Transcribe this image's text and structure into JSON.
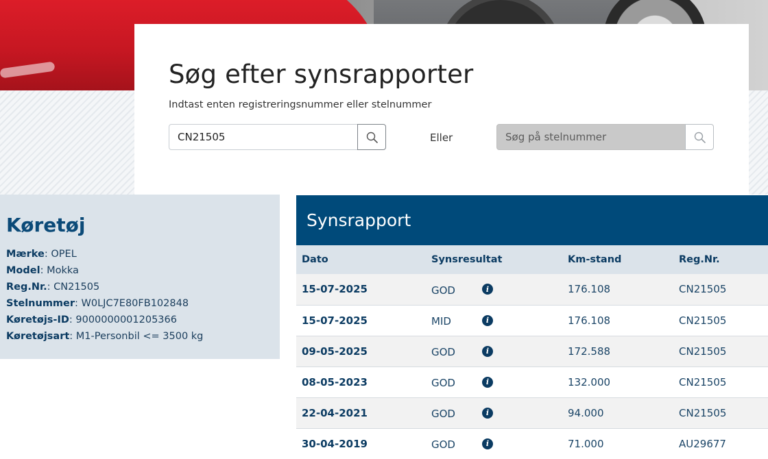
{
  "search": {
    "title": "Søg efter synsrapporter",
    "subtitle": "Indtast enten registreringsnummer eller stelnummer",
    "reg_value": "CN21505",
    "or_label": "Eller",
    "stel_placeholder": "Søg på stelnummer",
    "icon": "search-icon"
  },
  "vehicle": {
    "heading": "Køretøj",
    "fields": [
      {
        "label": "Mærke",
        "value": "OPEL"
      },
      {
        "label": "Model",
        "value": "Mokka"
      },
      {
        "label": "Reg.Nr.",
        "value": "CN21505"
      },
      {
        "label": "Stelnummer",
        "value": "W0LJC7E80FB102848"
      },
      {
        "label": "Køretøjs-ID",
        "value": "9000000001205366"
      },
      {
        "label": "Køretøjsart",
        "value": "M1-Personbil <= 3500 kg"
      }
    ]
  },
  "report": {
    "heading": "Synsrapport",
    "columns": [
      "Dato",
      "Synsresultat",
      "Km-stand",
      "Reg.Nr."
    ],
    "rows": [
      {
        "date": "15-07-2025",
        "result": "GOD",
        "km": "176.108",
        "reg": "CN21505"
      },
      {
        "date": "15-07-2025",
        "result": "MID",
        "km": "176.108",
        "reg": "CN21505"
      },
      {
        "date": "09-05-2025",
        "result": "GOD",
        "km": "172.588",
        "reg": "CN21505"
      },
      {
        "date": "08-05-2023",
        "result": "GOD",
        "km": "132.000",
        "reg": "CN21505"
      },
      {
        "date": "22-04-2021",
        "result": "GOD",
        "km": "94.000",
        "reg": "CN21505"
      },
      {
        "date": "30-04-2019",
        "result": "GOD",
        "km": "71.000",
        "reg": "AU29677"
      }
    ],
    "info_icon": "info-icon"
  },
  "colors": {
    "header_blue": "#004a7a",
    "panel_blue": "#dbe3ea",
    "text_blue": "#0b3b62"
  }
}
